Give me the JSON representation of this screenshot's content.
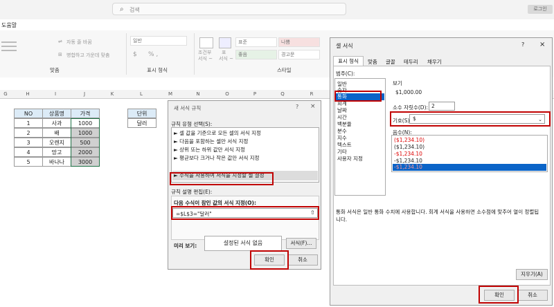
{
  "titlebar": {
    "search_placeholder": "검색",
    "login": "로그인"
  },
  "menu": {
    "help": "도움말"
  },
  "ribbon": {
    "wrap_text": "자동 줄 바꿈",
    "merge_center": "병합하고 가운데 맞춤",
    "align_group": "맞춤",
    "number_format_value": "일반",
    "number_symbols": "% ,",
    "number_group": "표시 형식",
    "conditional": "조건부",
    "conditional2": "서식 ~",
    "table": "표",
    "table2": "서식 ~",
    "styles": [
      "표준",
      "나쁨",
      "좋음",
      "경고문"
    ],
    "style_group": "스타일"
  },
  "sheet": {
    "columns": [
      "G",
      "H",
      "I",
      "J",
      "K",
      "L",
      "M",
      "N",
      "O",
      "P",
      "Q",
      "R"
    ],
    "table_header": [
      "NO",
      "상품명",
      "가격"
    ],
    "rows": [
      [
        "1",
        "사과",
        "1000"
      ],
      [
        "2",
        "배",
        "1000"
      ],
      [
        "3",
        "오렌지",
        "500"
      ],
      [
        "4",
        "망고",
        "2000"
      ],
      [
        "5",
        "바나나",
        "3000"
      ]
    ],
    "unit_header": "단위",
    "unit_value": "달러"
  },
  "rule_dialog": {
    "title": "새 서식 규칙",
    "help": "?",
    "close": "×",
    "type_label": "규칙 유형 선택(S):",
    "types": [
      "► 셀 값을 기준으로 모든 셀의 서식 지정",
      "► 다음을 포함하는 셀만 서식 지정",
      "► 상위 또는 하위 값만 서식 지정",
      "► 평균보다 크거나 작은 값만 서식 지정",
      "► 수식을 사용하여 서식을 지정할 셀 결정"
    ],
    "edit_label": "규칙 설명 편집(E):",
    "formula_label": "다음 수식이 참인 값의 서식 지정(O):",
    "formula": "=$L$3=\"달러\"",
    "preview_label": "미리 보기:",
    "preview_text": "설정된 서식 없음",
    "format_button": "서식(F)...",
    "ok": "확인",
    "cancel": "취소"
  },
  "format_dialog": {
    "title": "셀 서식",
    "help": "?",
    "close": "×",
    "tabs": [
      "표시 형식",
      "맞춤",
      "글꼴",
      "테두리",
      "채우기"
    ],
    "category_label": "범주(C):",
    "categories": [
      "일반",
      "숫자",
      "통화",
      "회계",
      "날짜",
      "시간",
      "백분율",
      "분수",
      "지수",
      "텍스트",
      "기타",
      "사용자 지정"
    ],
    "sample_label": "보기",
    "sample_value": "$1,000.00",
    "decimal_label": "소수 자릿수(D):",
    "decimal_value": "2",
    "symbol_label": "기호(S):",
    "symbol_value": "$",
    "negative_label": "음수(N):",
    "negatives": [
      "($1,234.10)",
      "($1,234.10)",
      "-$1,234.10",
      "-$1,234.10",
      "-$1,234.10"
    ],
    "description": "통화 서식은 일반 통화 수치에 사용합니다. 회계 서식을 사용하면 소수점에 맞추어 열이 정렬됩니다.",
    "clear": "지우기(A)",
    "ok": "확인",
    "cancel": "취소"
  },
  "colors": {
    "accent": "#c00000",
    "selection": "#0a64c8",
    "header_fill": "#dcebf7"
  }
}
